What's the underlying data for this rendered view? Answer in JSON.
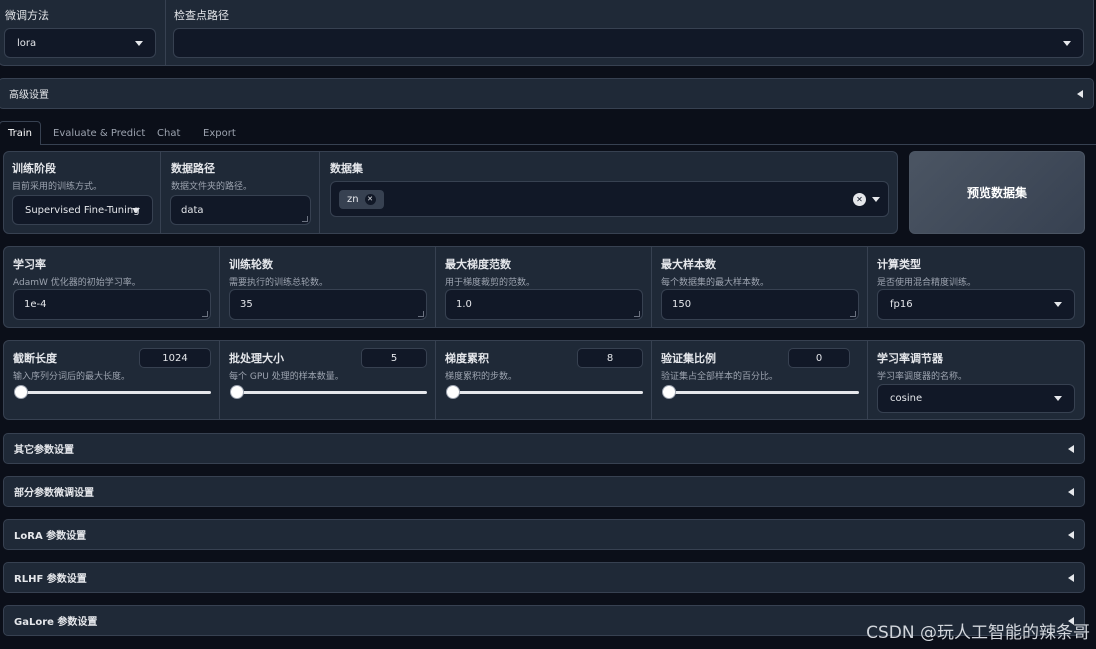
{
  "top": {
    "finetune_label": "微调方法",
    "finetune_value": "lora",
    "checkpoint_label": "检查点路径",
    "checkpoint_value": ""
  },
  "advanced": {
    "label": "高级设置"
  },
  "tabs": [
    "Train",
    "Evaluate & Predict",
    "Chat",
    "Export"
  ],
  "stage": {
    "label": "训练阶段",
    "desc": "目前采用的训练方式。",
    "value": "Supervised Fine-Tuning"
  },
  "dataset_dir": {
    "label": "数据路径",
    "desc": "数据文件夹的路径。",
    "value": "data"
  },
  "dataset": {
    "label": "数据集",
    "tag": "zn"
  },
  "preview_button": "预览数据集",
  "row2": [
    {
      "label": "学习率",
      "desc": "AdamW 优化器的初始学习率。",
      "value": "1e-4"
    },
    {
      "label": "训练轮数",
      "desc": "需要执行的训练总轮数。",
      "value": "35"
    },
    {
      "label": "最大梯度范数",
      "desc": "用于梯度裁剪的范数。",
      "value": "1.0"
    },
    {
      "label": "最大样本数",
      "desc": "每个数据集的最大样本数。",
      "value": "150"
    },
    {
      "label": "计算类型",
      "desc": "是否使用混合精度训练。",
      "value": "fp16"
    }
  ],
  "row3": [
    {
      "label": "截断长度",
      "desc": "输入序列分词后的最大长度。",
      "value": "1024",
      "level": 0.0
    },
    {
      "label": "批处理大小",
      "desc": "每个 GPU 处理的样本数量。",
      "value": "5",
      "level": 0.0
    },
    {
      "label": "梯度累积",
      "desc": "梯度累积的步数。",
      "value": "8",
      "level": 0.0
    },
    {
      "label": "验证集比例",
      "desc": "验证集占全部样本的百分比。",
      "value": "0",
      "level": 0.0
    },
    {
      "label": "学习率调节器",
      "desc": "学习率调度器的名称。",
      "value": "cosine"
    }
  ],
  "accordions": [
    "其它参数设置",
    "部分参数微调设置",
    "LoRA 参数设置",
    "RLHF 参数设置",
    "GaLore 参数设置"
  ],
  "watermark": "CSDN @玩人工智能的辣条哥"
}
